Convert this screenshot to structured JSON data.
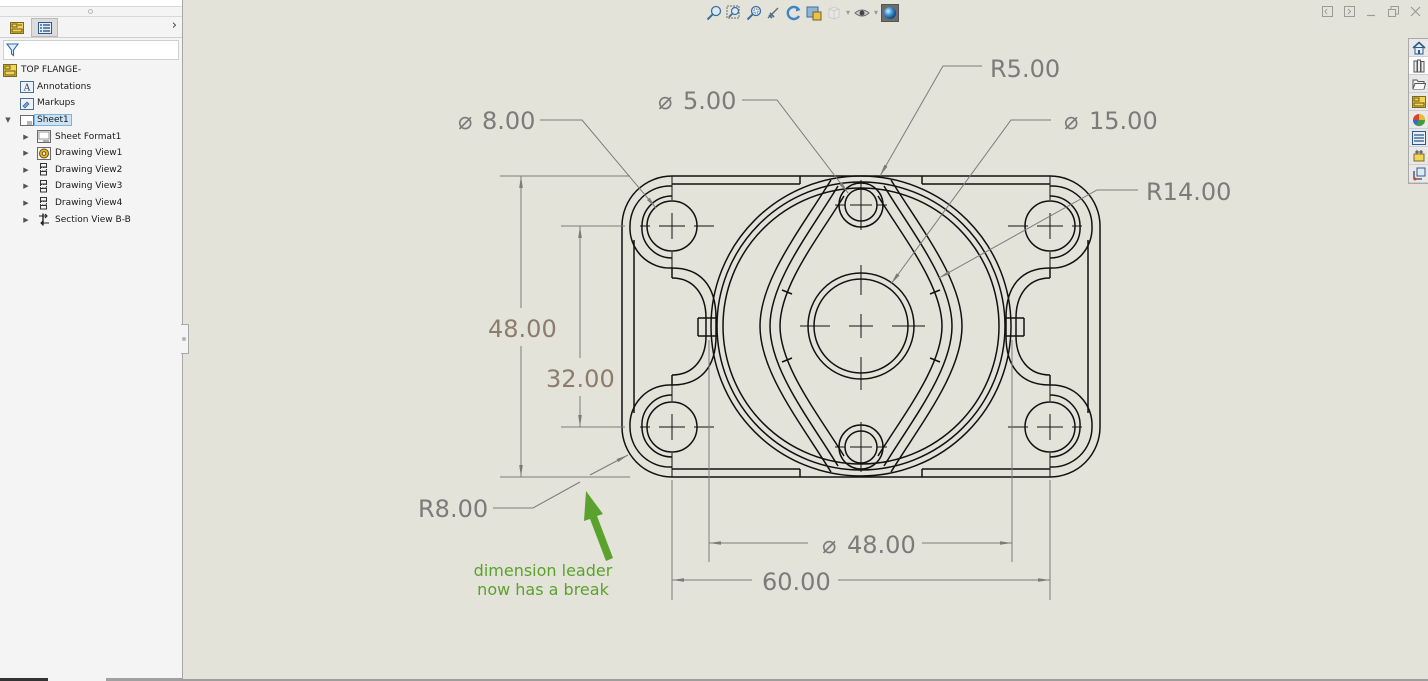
{
  "panel": {
    "tabs": [
      {
        "name": "feature-manager",
        "icon": "drawing-tree-icon"
      },
      {
        "name": "property-manager",
        "icon": "property-list-icon"
      }
    ],
    "expand_glyph": "›",
    "filter_icon": "filter-funnel-icon",
    "tree": {
      "root": {
        "label": "TOP FLANGE-",
        "icon": "drawing-doc-icon"
      },
      "items": [
        {
          "label": "Annotations",
          "icon": "annotations-folder-icon",
          "expandable": false
        },
        {
          "label": "Markups",
          "icon": "markups-folder-icon",
          "expandable": false
        },
        {
          "label": "Sheet1",
          "icon": "sheet-icon",
          "expandable": true,
          "expanded": true,
          "selected": true
        },
        {
          "label": "Sheet Format1",
          "icon": "sheet-format-icon",
          "expandable": true,
          "indent": 1
        },
        {
          "label": "Drawing View1",
          "icon": "model-view-icon",
          "expandable": true,
          "indent": 1
        },
        {
          "label": "Drawing View2",
          "icon": "drawing-view-icon",
          "expandable": true,
          "indent": 1
        },
        {
          "label": "Drawing View3",
          "icon": "drawing-view-icon",
          "expandable": true,
          "indent": 1
        },
        {
          "label": "Drawing View4",
          "icon": "drawing-view-icon",
          "expandable": true,
          "indent": 1
        },
        {
          "label": "Section View B-B",
          "icon": "section-view-icon",
          "expandable": true,
          "indent": 1
        }
      ]
    }
  },
  "hud_toolbar": [
    {
      "name": "zoom-to-fit",
      "icon": "zoom-to-fit-icon"
    },
    {
      "name": "zoom-to-area",
      "icon": "zoom-to-area-icon"
    },
    {
      "name": "zoom-to-selection",
      "icon": "zoom-to-selection-icon"
    },
    {
      "name": "previous-view",
      "icon": "previous-view-icon"
    },
    {
      "name": "rebuild",
      "icon": "rebuild-icon"
    },
    {
      "name": "apply-scene",
      "icon": "apply-scene-icon"
    },
    {
      "name": "display-style",
      "icon": "display-style-icon",
      "disabled": true,
      "dropdown": true
    },
    {
      "name": "hide-show-items",
      "icon": "hide-show-icon",
      "dropdown": true
    },
    {
      "name": "appearance",
      "icon": "appearance-sphere-icon",
      "active": true
    }
  ],
  "window_controls": [
    "tile-left",
    "tile-right",
    "minimize",
    "restore",
    "close"
  ],
  "task_pane": [
    {
      "name": "solidworks-resources",
      "icon": "home-icon"
    },
    {
      "name": "design-library",
      "icon": "design-library-icon",
      "active": true
    },
    {
      "name": "file-explorer",
      "icon": "folder-open-icon"
    },
    {
      "name": "view-palette",
      "icon": "view-palette-icon"
    },
    {
      "name": "appearances-scenes",
      "icon": "appearance-ball-icon"
    },
    {
      "name": "custom-properties",
      "icon": "custom-properties-icon"
    },
    {
      "name": "solidworks-forum",
      "icon": "forum-icon"
    },
    {
      "name": "3d-content",
      "icon": "content-central-icon"
    }
  ],
  "drawing": {
    "dimensions": {
      "hole_dia_corner": {
        "prefix": "⌀",
        "value": "8.00"
      },
      "hole_dia_small": {
        "prefix": "⌀",
        "value": "5.00"
      },
      "radius_boss": {
        "value": "R5.00"
      },
      "hole_dia_center": {
        "prefix": "⌀",
        "value": "15.00"
      },
      "radius_rib": {
        "value": "R14.00"
      },
      "overall_height": {
        "value": "48.00"
      },
      "hole_spacing_vertical": {
        "value": "32.00"
      },
      "radius_corner": {
        "value": "R8.00"
      },
      "flange_dia": {
        "prefix": "⌀",
        "value": "48.00"
      },
      "overall_width": {
        "value": "60.00"
      }
    },
    "annotation": {
      "lines": [
        "dimension leader",
        "now has a break"
      ],
      "color": "#5aa22d"
    },
    "colors": {
      "geometry": "#111111",
      "dimension": "#7b7b7b",
      "driven_dimension": "#8b7c6e",
      "background": "#e4e3da"
    }
  }
}
